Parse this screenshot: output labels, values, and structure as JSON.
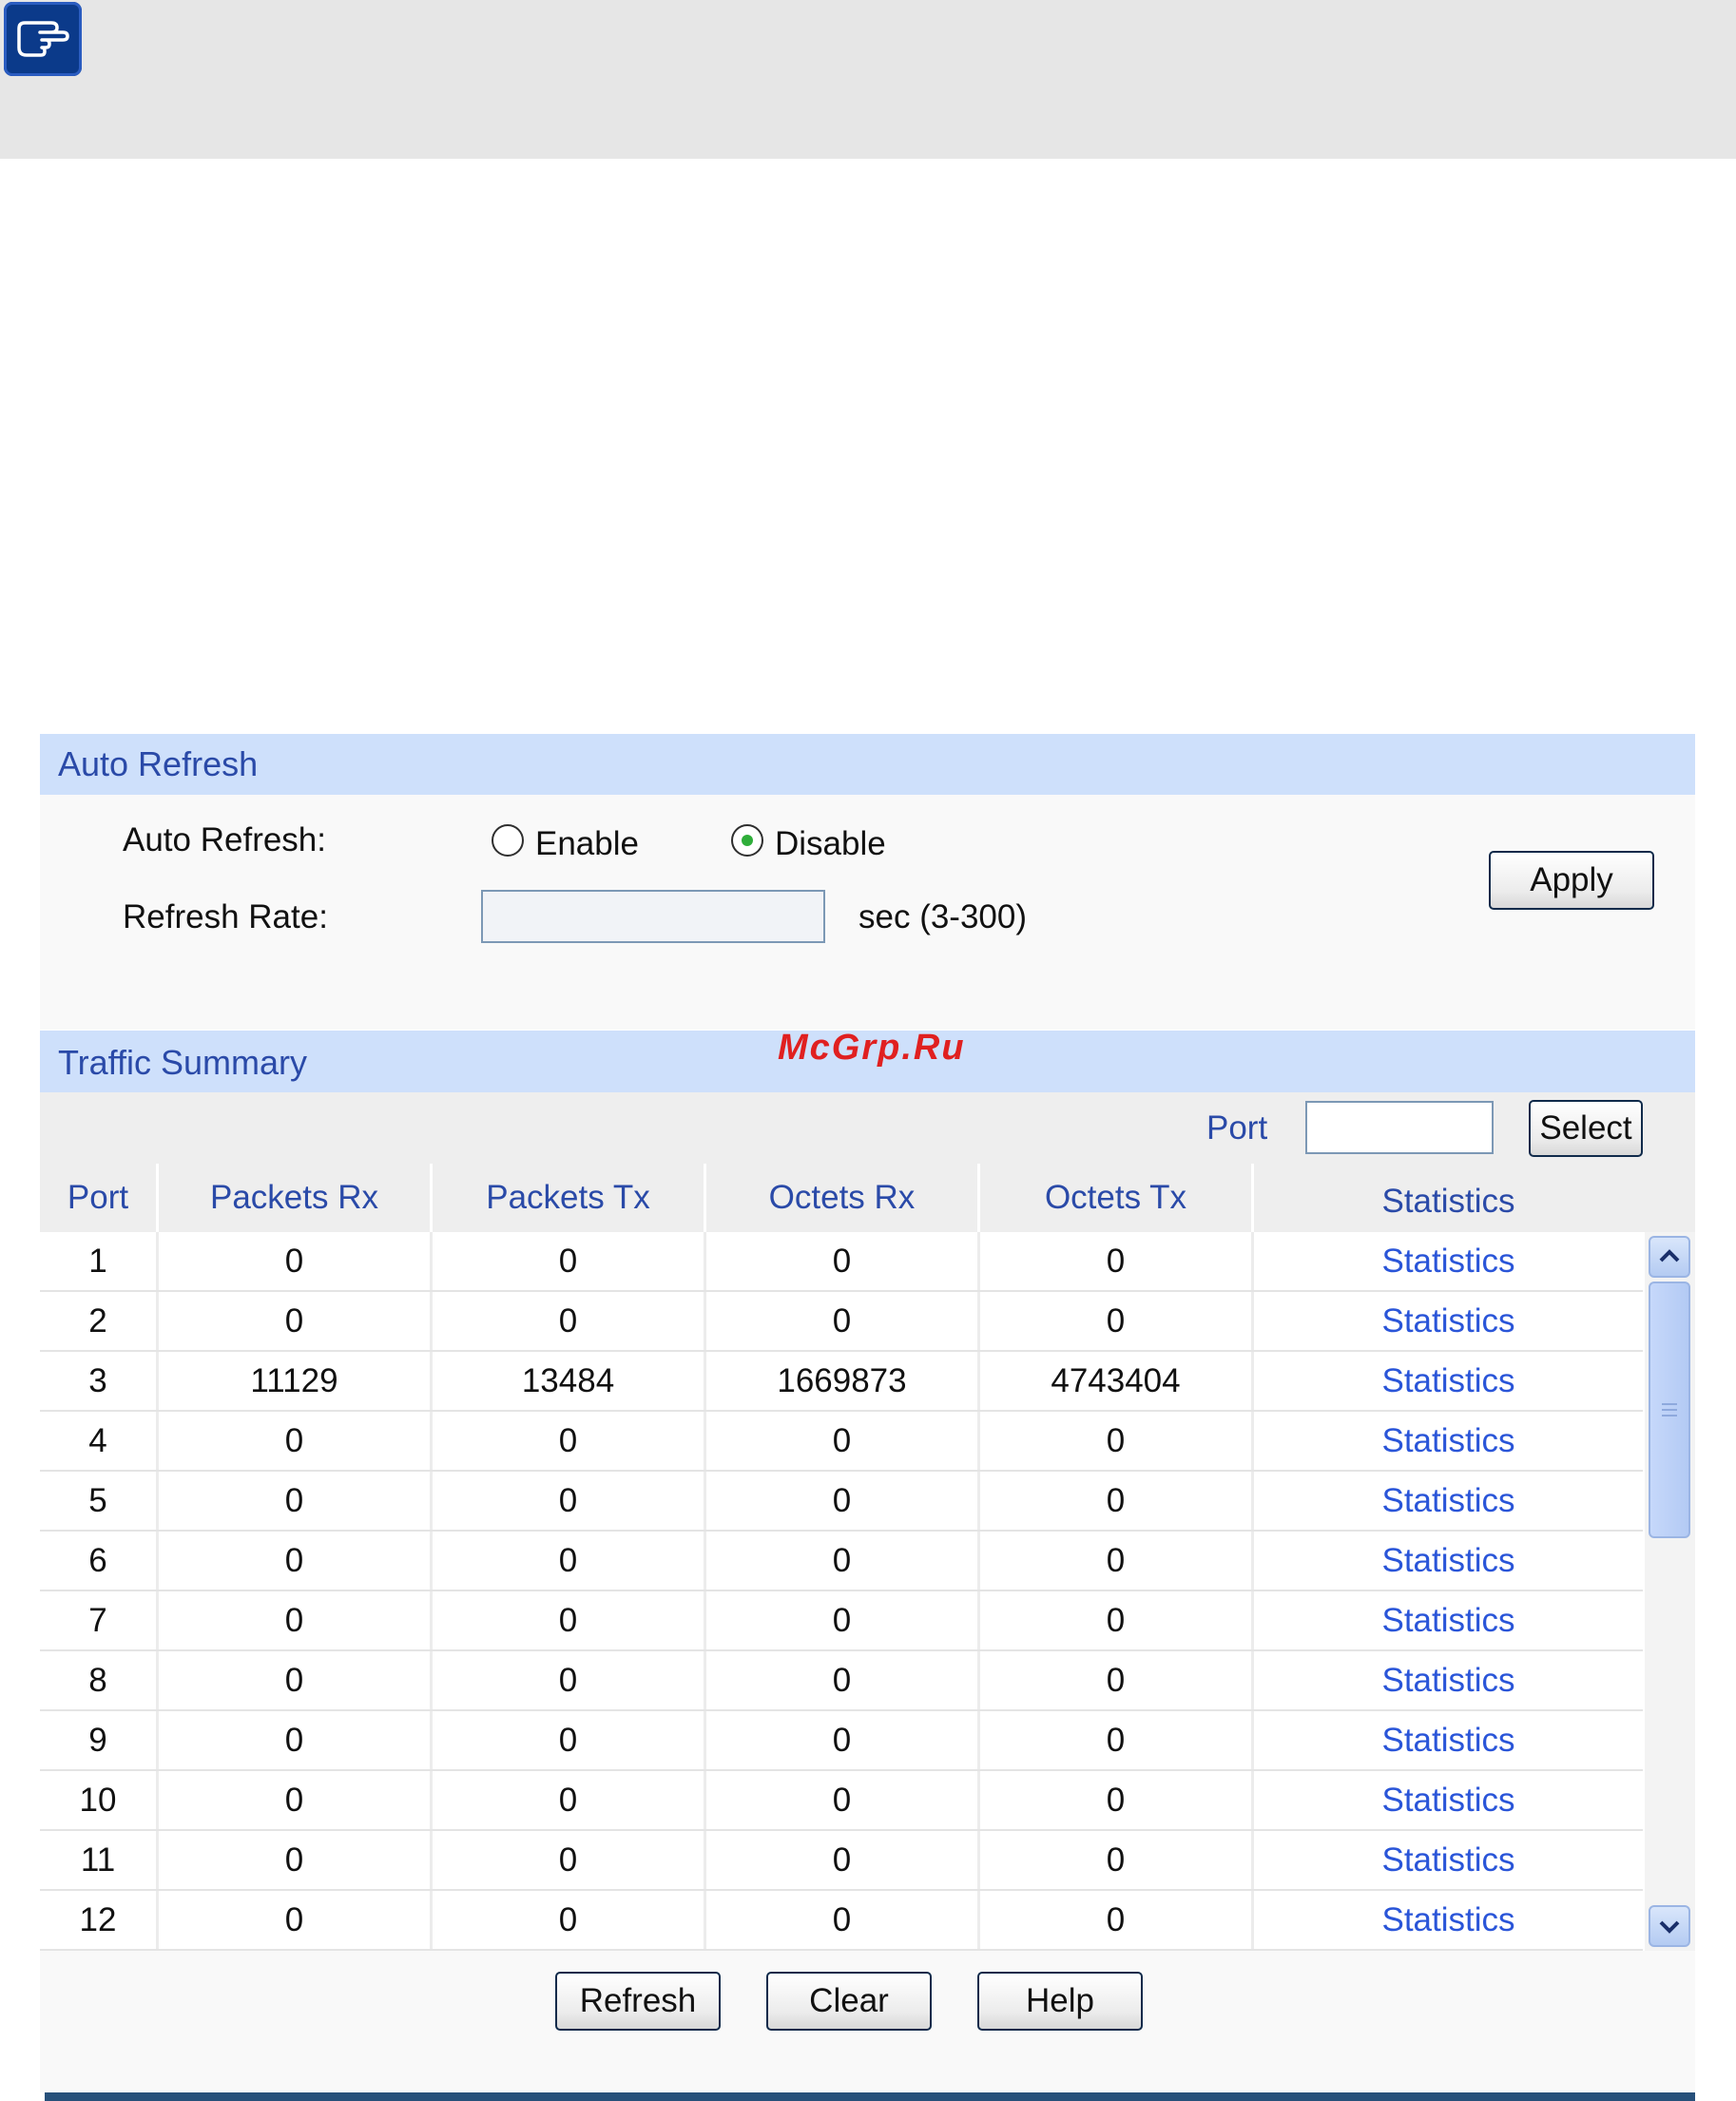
{
  "note": {
    "icon": "pointing-hand-icon"
  },
  "watermark": "McGrp.Ru",
  "auto_refresh": {
    "section_title": "Auto Refresh",
    "auto_refresh_label": "Auto Refresh:",
    "enable_label": "Enable",
    "disable_label": "Disable",
    "selected": "Disable",
    "refresh_rate_label": "Refresh Rate:",
    "refresh_rate_value": "",
    "refresh_rate_unit": "sec (3-300)",
    "apply_label": "Apply"
  },
  "traffic_summary": {
    "section_title": "Traffic Summary",
    "port_filter_label": "Port",
    "port_filter_value": "",
    "select_label": "Select",
    "columns": [
      "Port",
      "Packets Rx",
      "Packets Tx",
      "Octets Rx",
      "Octets Tx",
      "Statistics"
    ],
    "rows": [
      {
        "port": "1",
        "packets_rx": "0",
        "packets_tx": "0",
        "octets_rx": "0",
        "octets_tx": "0",
        "link": "Statistics"
      },
      {
        "port": "2",
        "packets_rx": "0",
        "packets_tx": "0",
        "octets_rx": "0",
        "octets_tx": "0",
        "link": "Statistics"
      },
      {
        "port": "3",
        "packets_rx": "11129",
        "packets_tx": "13484",
        "octets_rx": "1669873",
        "octets_tx": "4743404",
        "link": "Statistics"
      },
      {
        "port": "4",
        "packets_rx": "0",
        "packets_tx": "0",
        "octets_rx": "0",
        "octets_tx": "0",
        "link": "Statistics"
      },
      {
        "port": "5",
        "packets_rx": "0",
        "packets_tx": "0",
        "octets_rx": "0",
        "octets_tx": "0",
        "link": "Statistics"
      },
      {
        "port": "6",
        "packets_rx": "0",
        "packets_tx": "0",
        "octets_rx": "0",
        "octets_tx": "0",
        "link": "Statistics"
      },
      {
        "port": "7",
        "packets_rx": "0",
        "packets_tx": "0",
        "octets_rx": "0",
        "octets_tx": "0",
        "link": "Statistics"
      },
      {
        "port": "8",
        "packets_rx": "0",
        "packets_tx": "0",
        "octets_rx": "0",
        "octets_tx": "0",
        "link": "Statistics"
      },
      {
        "port": "9",
        "packets_rx": "0",
        "packets_tx": "0",
        "octets_rx": "0",
        "octets_tx": "0",
        "link": "Statistics"
      },
      {
        "port": "10",
        "packets_rx": "0",
        "packets_tx": "0",
        "octets_rx": "0",
        "octets_tx": "0",
        "link": "Statistics"
      },
      {
        "port": "11",
        "packets_rx": "0",
        "packets_tx": "0",
        "octets_rx": "0",
        "octets_tx": "0",
        "link": "Statistics"
      },
      {
        "port": "12",
        "packets_rx": "0",
        "packets_tx": "0",
        "octets_rx": "0",
        "octets_tx": "0",
        "link": "Statistics"
      }
    ],
    "refresh_label": "Refresh",
    "clear_label": "Clear",
    "help_label": "Help"
  }
}
